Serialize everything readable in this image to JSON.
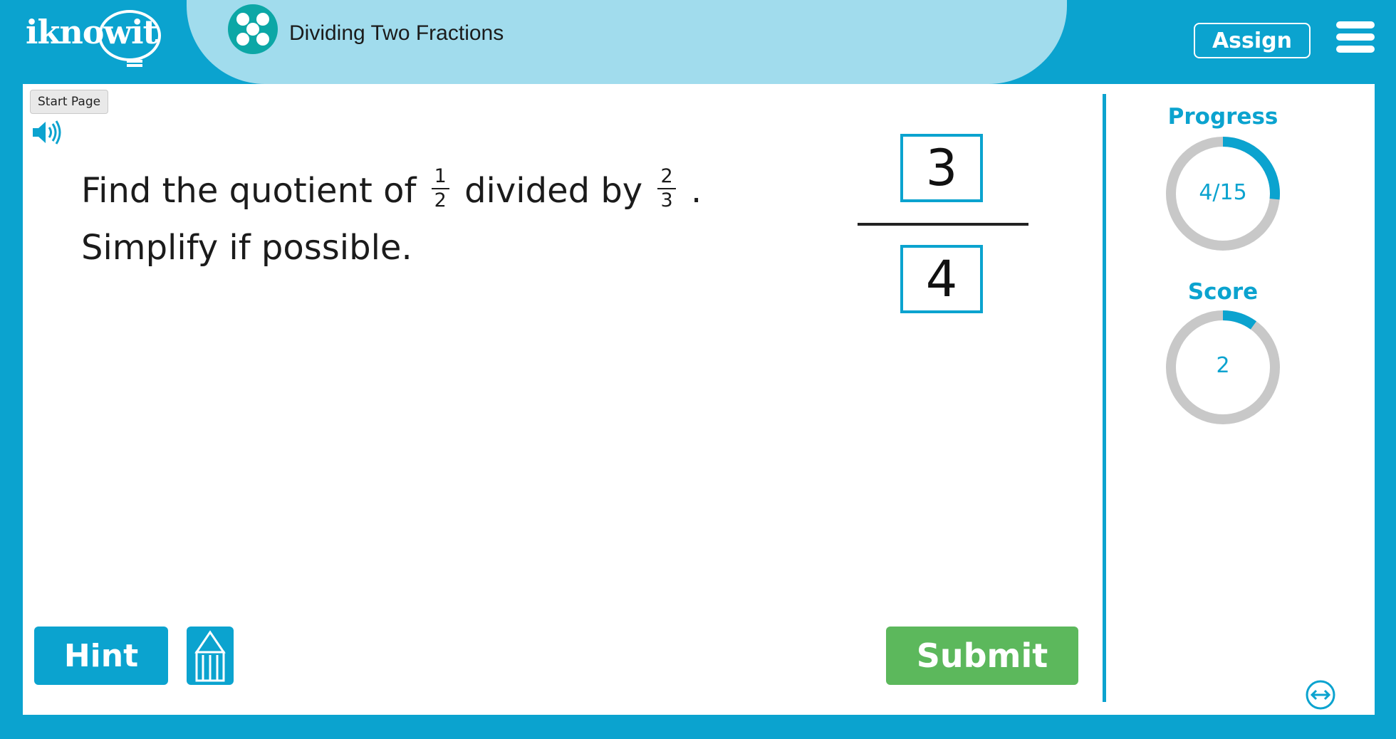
{
  "header": {
    "logo_text": "iknowit",
    "lesson_title": "Dividing Two Fractions",
    "lesson_icon": "dots-icon",
    "assign_label": "Assign",
    "menu_icon": "hamburger-menu-icon"
  },
  "toolbar": {
    "start_page_label": "Start Page",
    "speaker_icon": "speaker-icon"
  },
  "question": {
    "prefix": "Find the quotient of",
    "frac1_num": "1",
    "frac1_den": "2",
    "middle": "divided by",
    "frac2_num": "2",
    "frac2_den": "3",
    "suffix": ".",
    "line2": "Simplify if possible."
  },
  "answer": {
    "numerator": "3",
    "denominator": "4"
  },
  "panel": {
    "progress_label": "Progress",
    "progress_text": "4/15",
    "progress_fraction": 0.2667,
    "score_label": "Score",
    "score_text": "2",
    "score_fraction": 0.1
  },
  "buttons": {
    "hint_label": "Hint",
    "pencil_icon": "pencil-icon",
    "submit_label": "Submit",
    "expand_icon": "horizontal-arrows-icon"
  },
  "colors": {
    "brand_blue": "#0ba3cf",
    "title_bar": "#a1dced",
    "submit_green": "#5cb85c",
    "ring_gray": "#c8c8c8"
  }
}
